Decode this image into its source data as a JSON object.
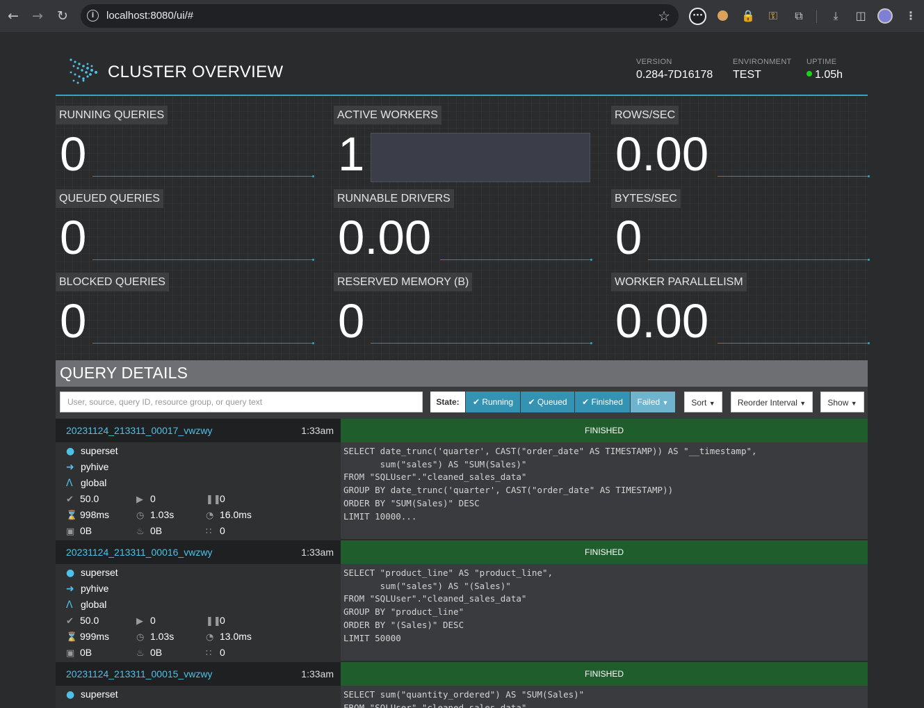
{
  "browser": {
    "url": "localhost:8080/ui/#"
  },
  "header": {
    "title": "CLUSTER OVERVIEW",
    "version_label": "VERSION",
    "version": "0.284-7D16178",
    "environment_label": "ENVIRONMENT",
    "environment": "TEST",
    "uptime_label": "UPTIME",
    "uptime": "1.05h"
  },
  "stats": {
    "running_queries": {
      "label": "RUNNING QUERIES",
      "value": "0"
    },
    "active_workers": {
      "label": "ACTIVE WORKERS",
      "value": "1"
    },
    "rows_sec": {
      "label": "ROWS/SEC",
      "value": "0.00"
    },
    "queued_queries": {
      "label": "QUEUED QUERIES",
      "value": "0"
    },
    "runnable_drivers": {
      "label": "RUNNABLE DRIVERS",
      "value": "0.00"
    },
    "bytes_sec": {
      "label": "BYTES/SEC",
      "value": "0"
    },
    "blocked_queries": {
      "label": "BLOCKED QUERIES",
      "value": "0"
    },
    "reserved_memory": {
      "label": "RESERVED MEMORY (B)",
      "value": "0"
    },
    "worker_parallelism": {
      "label": "WORKER PARALLELISM",
      "value": "0.00"
    }
  },
  "query_details": {
    "title": "QUERY DETAILS",
    "search_placeholder": "User, source, query ID, resource group, or query text",
    "state_label": "State:",
    "filter_running": "Running",
    "filter_queued": "Queued",
    "filter_finished": "Finished",
    "filter_failed": "Failed",
    "sort_label": "Sort",
    "reorder_label": "Reorder Interval",
    "show_label": "Show"
  },
  "queries": [
    {
      "id": "20231124_213311_00017_vwzwy",
      "time": "1:33am",
      "state": "FINISHED",
      "user": "superset",
      "source": "pyhive",
      "resource_group": "global",
      "completed_splits": "50.0",
      "running_splits": "0",
      "queued_splits": "0",
      "wall_time": "998ms",
      "elapsed_time": "1.03s",
      "cpu_time": "16.0ms",
      "current_memory": "0B",
      "peak_memory": "0B",
      "cumulative": "0",
      "sql": "SELECT date_trunc('quarter', CAST(\"order_date\" AS TIMESTAMP)) AS \"__timestamp\",\n       sum(\"sales\") AS \"SUM(Sales)\"\nFROM \"SQLUser\".\"cleaned_sales_data\"\nGROUP BY date_trunc('quarter', CAST(\"order_date\" AS TIMESTAMP))\nORDER BY \"SUM(Sales)\" DESC\nLIMIT 10000..."
    },
    {
      "id": "20231124_213311_00016_vwzwy",
      "time": "1:33am",
      "state": "FINISHED",
      "user": "superset",
      "source": "pyhive",
      "resource_group": "global",
      "completed_splits": "50.0",
      "running_splits": "0",
      "queued_splits": "0",
      "wall_time": "999ms",
      "elapsed_time": "1.03s",
      "cpu_time": "13.0ms",
      "current_memory": "0B",
      "peak_memory": "0B",
      "cumulative": "0",
      "sql": "SELECT \"product_line\" AS \"product_line\",\n       sum(\"sales\") AS \"(Sales)\"\nFROM \"SQLUser\".\"cleaned_sales_data\"\nGROUP BY \"product_line\"\nORDER BY \"(Sales)\" DESC\nLIMIT 50000"
    },
    {
      "id": "20231124_213311_00015_vwzwy",
      "time": "1:33am",
      "state": "FINISHED",
      "user": "superset",
      "sql": "SELECT sum(\"quantity_ordered\") AS \"SUM(Sales)\"\nFROM \"SQLUser\".\"cleaned_sales_data\""
    }
  ],
  "colors": {
    "accent": "#34a5c7",
    "finished": "#1f5e2c",
    "query_link": "#4fc1e9",
    "uptime_dot": "#19d419"
  }
}
